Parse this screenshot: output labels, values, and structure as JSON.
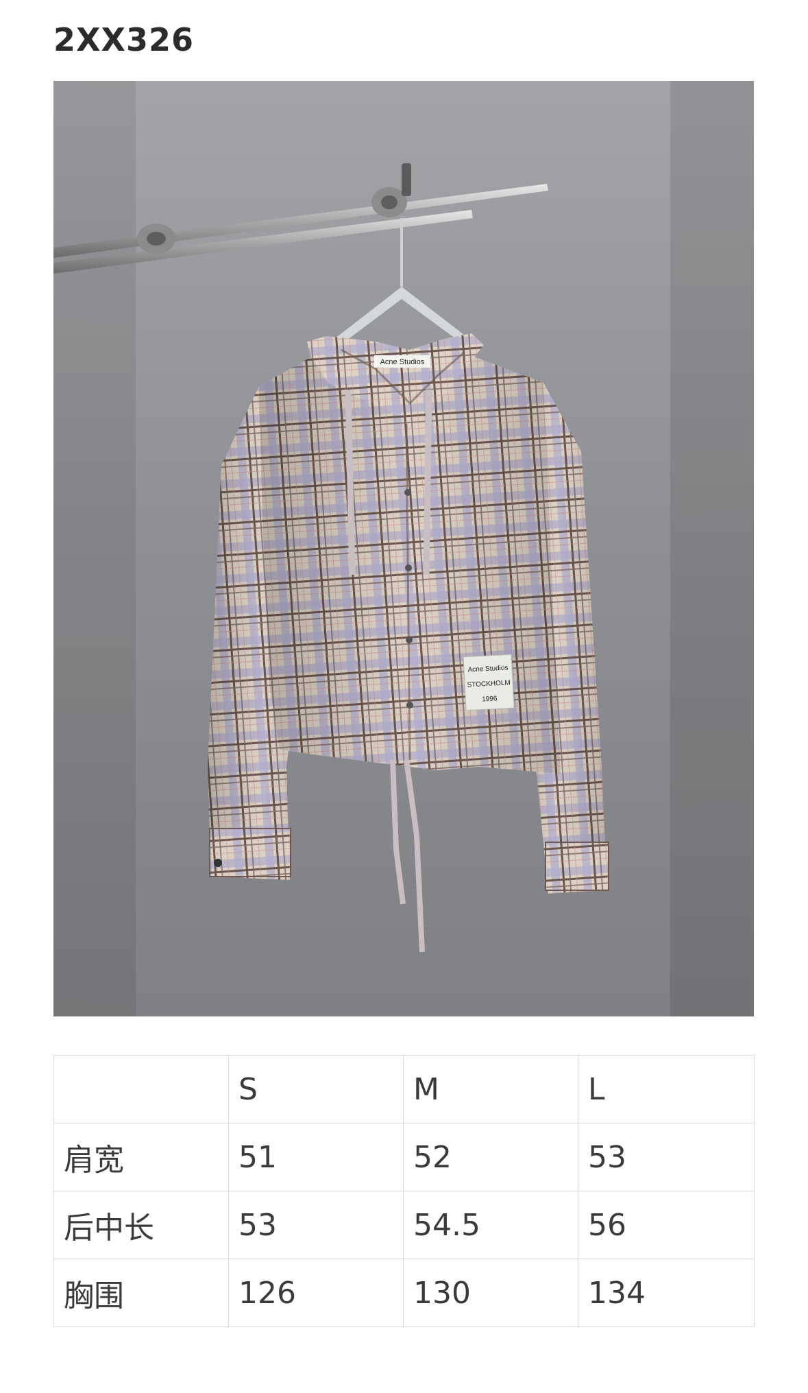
{
  "product": {
    "code": "2XX326"
  },
  "photo": {
    "label_tag_top": "Acne Studios",
    "label_patch": [
      "Acne Studios",
      "STOCKHOLM",
      "1996"
    ]
  },
  "size_table": {
    "header": [
      "",
      "S",
      "M",
      "L"
    ],
    "rows": [
      {
        "label": "肩宽",
        "values": [
          "51",
          "52",
          "53"
        ]
      },
      {
        "label": "后中长",
        "values": [
          "53",
          "54.5",
          "56"
        ]
      },
      {
        "label": "胸围",
        "values": [
          "126",
          "130",
          "134"
        ]
      }
    ]
  },
  "colors": {
    "plaid_base": "#d9cfc4",
    "plaid_lavender": "#a9a4c6",
    "plaid_brown": "#6b5650",
    "backdrop": "#8f9194"
  }
}
